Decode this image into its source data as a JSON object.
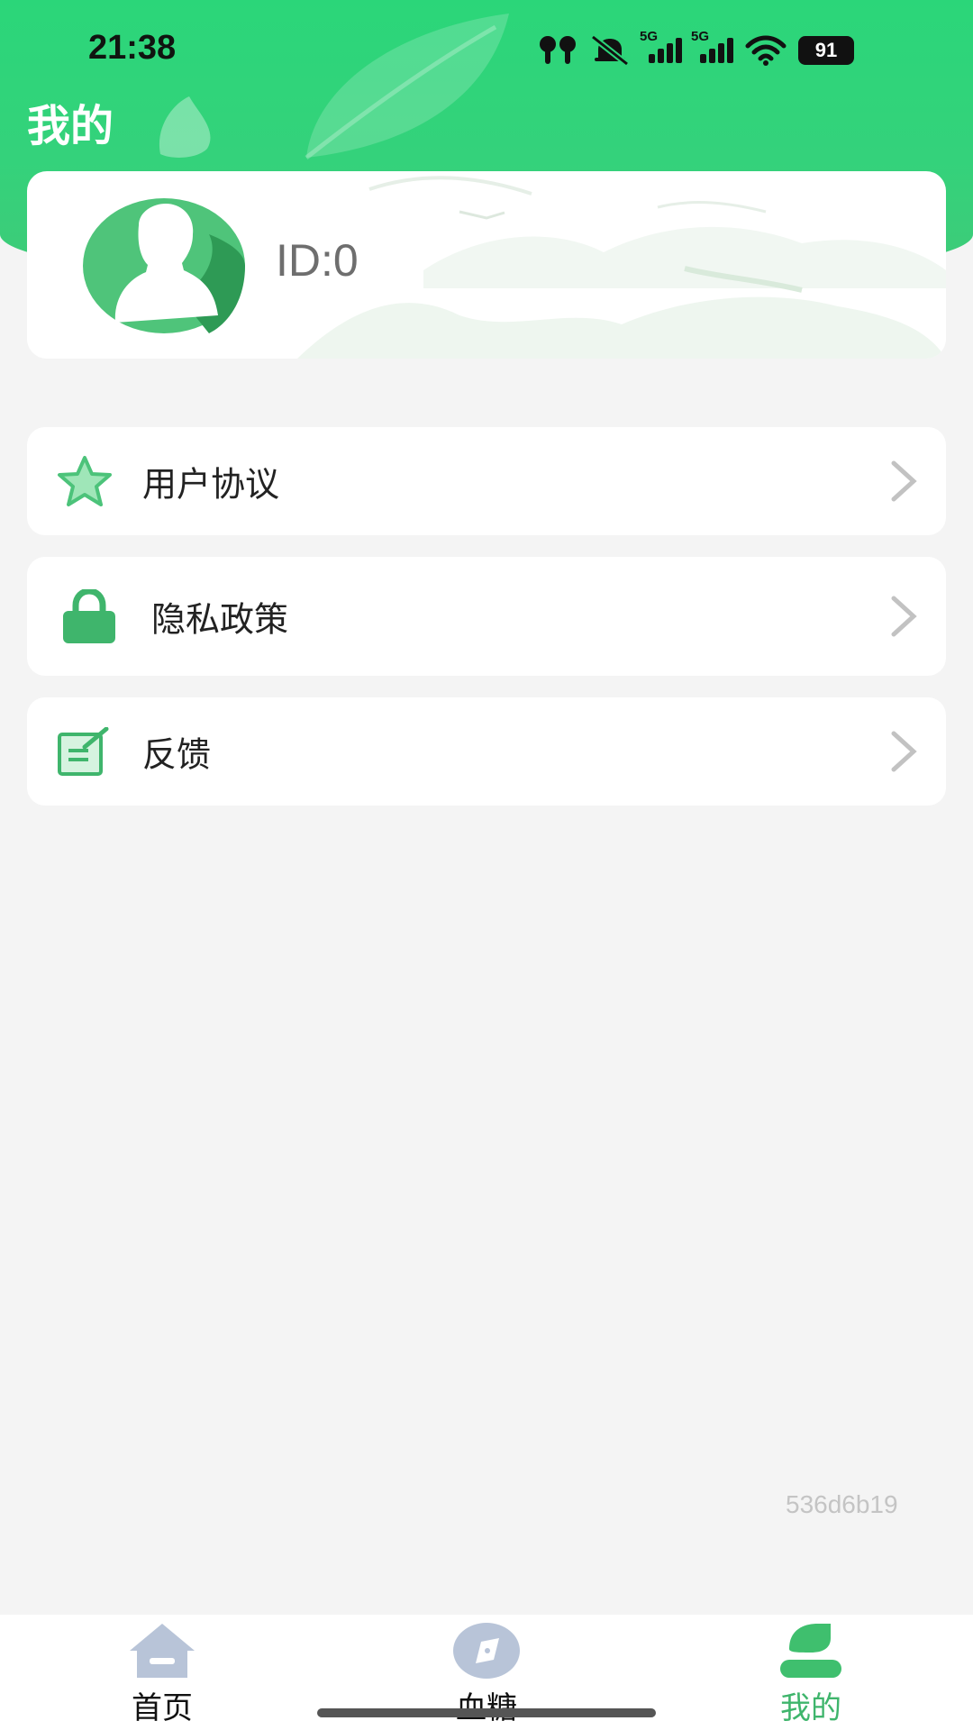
{
  "status_bar": {
    "time": "21:38",
    "battery": "91",
    "network_1": "5G",
    "network_2": "5G",
    "icons": [
      "airpods-icon",
      "mute-bell-icon",
      "signal-5g-icon",
      "signal-5g-icon",
      "wifi-icon",
      "battery-icon"
    ]
  },
  "header": {
    "title": "我的"
  },
  "profile": {
    "id_text": "ID:0",
    "avatar_icon": "person-silhouette-icon"
  },
  "menu": {
    "items": [
      {
        "label": "用户协议",
        "icon": "star-icon"
      },
      {
        "label": "隐私政策",
        "icon": "lock-icon"
      },
      {
        "label": "反馈",
        "icon": "feedback-edit-icon"
      }
    ]
  },
  "version": "536d6b19",
  "tabbar": {
    "tabs": [
      {
        "label": "首页",
        "icon": "home-icon",
        "active": false
      },
      {
        "label": "血糖",
        "icon": "compass-icon",
        "active": false
      },
      {
        "label": "我的",
        "icon": "user-icon",
        "active": true
      }
    ]
  },
  "colors": {
    "brand_green": "#2bd679",
    "active_tab": "#3fb56c",
    "inactive_icon": "#b8c4d8",
    "background": "#f4f4f4"
  }
}
